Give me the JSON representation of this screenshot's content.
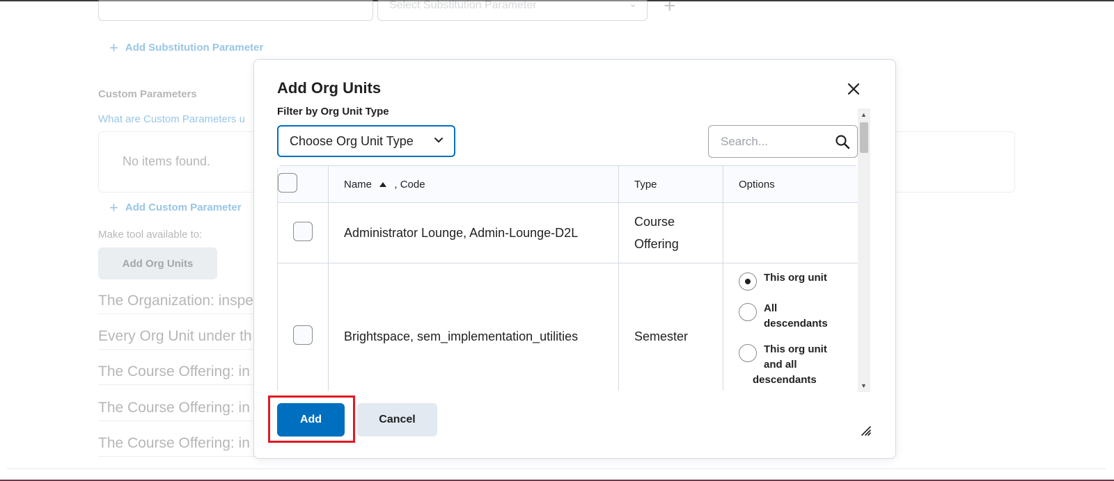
{
  "background": {
    "substitution_select_placeholder": "Select Substitution Parameter",
    "add_substitution_parameter": "Add Substitution Parameter",
    "custom_parameters_label": "Custom Parameters",
    "custom_parameters_help": "What are Custom Parameters u",
    "no_items": "No items found.",
    "add_custom_parameter": "Add Custom Parameter",
    "make_available_label": "Make tool available to:",
    "add_org_units_button": "Add Org Units",
    "rows": [
      "The Organization: inspe",
      "Every Org Unit under th",
      "The Course Offering: in",
      "The Course Offering: in",
      "The Course Offering: in"
    ]
  },
  "dialog": {
    "title": "Add Org Units",
    "filter_label": "Filter by Org Unit Type",
    "org_type_select": "Choose Org Unit Type",
    "search_placeholder": "Search...",
    "columns": {
      "name": "Name",
      "code": ", Code",
      "type": "Type",
      "options": "Options"
    },
    "rows": [
      {
        "name": "Administrator Lounge, Admin-Lounge-D2L",
        "type_line1": "Course",
        "type_line2": "Offering"
      },
      {
        "name": "Brightspace, sem_implementation_utilities",
        "type": "Semester"
      }
    ],
    "options": {
      "this_org_unit": "This org unit",
      "all_descendants_1": "All",
      "all_descendants_2": "descendants",
      "this_and_all_1": "This org unit",
      "this_and_all_2": "and all",
      "this_and_all_3": "descendants",
      "selected": "This org unit"
    },
    "add_button": "Add",
    "cancel_button": "Cancel"
  },
  "colors": {
    "primary": "#006fbf",
    "highlight": "#e11a24"
  }
}
